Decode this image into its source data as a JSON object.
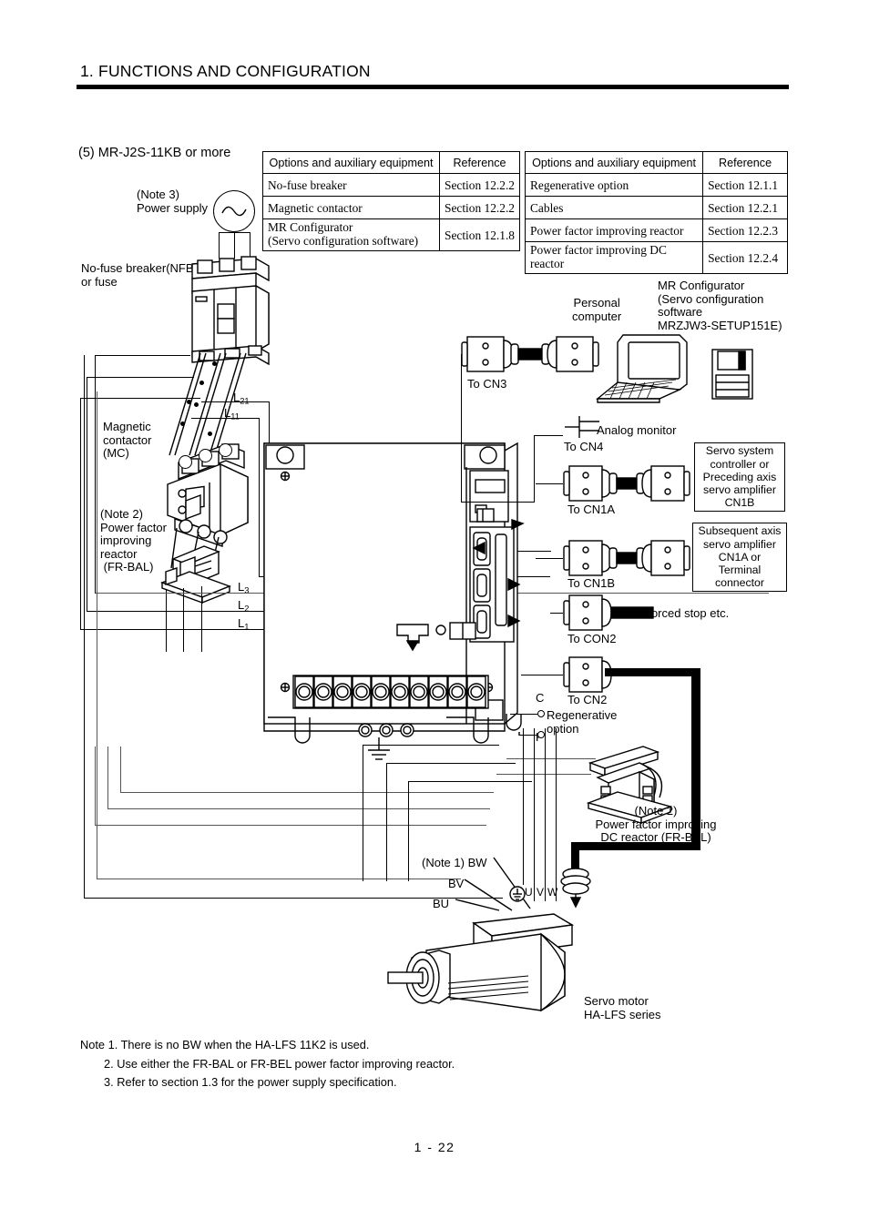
{
  "header": {
    "chapter_title": "1. FUNCTIONS AND CONFIGURATION"
  },
  "section": {
    "heading": "(5) MR-J2S-11KB or more"
  },
  "tables": {
    "left": {
      "columns": [
        "Options and auxiliary equipment",
        "Reference"
      ],
      "rows": [
        [
          "No-fuse breaker",
          "Section 12.2.2"
        ],
        [
          "Magnetic contactor",
          "Section 12.2.2"
        ],
        [
          "MR Configurator\n(Servo configuration software)",
          "Section 12.1.8"
        ]
      ]
    },
    "right": {
      "columns": [
        "Options and auxiliary equipment",
        "Reference"
      ],
      "rows": [
        [
          "Regenerative option",
          "Section 12.1.1"
        ],
        [
          "Cables",
          "Section 12.2.1"
        ],
        [
          "Power factor improving reactor",
          "Section 12.2.3"
        ],
        [
          "Power factor improving DC\nreactor",
          "Section 12.2.4"
        ]
      ]
    }
  },
  "diagram": {
    "power_supply": "(Note 3)\nPower supply",
    "nfb": "No-fuse breaker(NFB)\nor fuse",
    "magnetic_contactor": "Magnetic\ncontactor\n(MC)",
    "fr_bal": "(Note 2)\nPower factor\nimproving\nreactor\n (FR-BAL)",
    "l21": "L21",
    "l11": "L11",
    "l3": "L3",
    "l2": "L2",
    "l1": "L1",
    "personal_computer": "Personal\ncomputer",
    "mr_configurator": "MR Configurator\n(Servo configuration\nsoftware\nMRZJW3-SETUP151E)",
    "to_cn3": "To CN3",
    "analog_monitor": "Analog monitor",
    "to_cn4": "To CN4",
    "to_cn1a": "To CN1A",
    "to_cn1b": "To CN1B",
    "to_con2": "To CON2",
    "to_cn2": "To CN2",
    "forced_stop": "Forced stop etc.",
    "servo_system_controller_box": "Servo system\ncontroller or\nPreceding axis\nservo amplifier\nCN1B",
    "subsequent_axis_box": "Subsequent axis\nservo amplifier\nCN1A or\nTerminal\nconnector",
    "regen_c": "C",
    "regen_p": "P",
    "regenerative_option": "Regenerative\noption",
    "fr_bel": "(Note 2)\nPower factor improving\nDC reactor (FR-BEL)",
    "bw": "(Note 1) BW",
    "bv": "BV",
    "bu": "BU",
    "term_u": "U",
    "term_v": "V",
    "term_w": "W",
    "servo_motor": "Servo motor\nHA-LFS series"
  },
  "notes": {
    "note1": "Note 1. There is no BW when the HA-LFS 11K2 is used.",
    "note2": "2. Use either the FR-BAL or FR-BEL power factor improving reactor.",
    "note3": "3. Refer to section 1.3 for the power supply specification."
  },
  "footer": {
    "page_number": "1 -  22"
  }
}
